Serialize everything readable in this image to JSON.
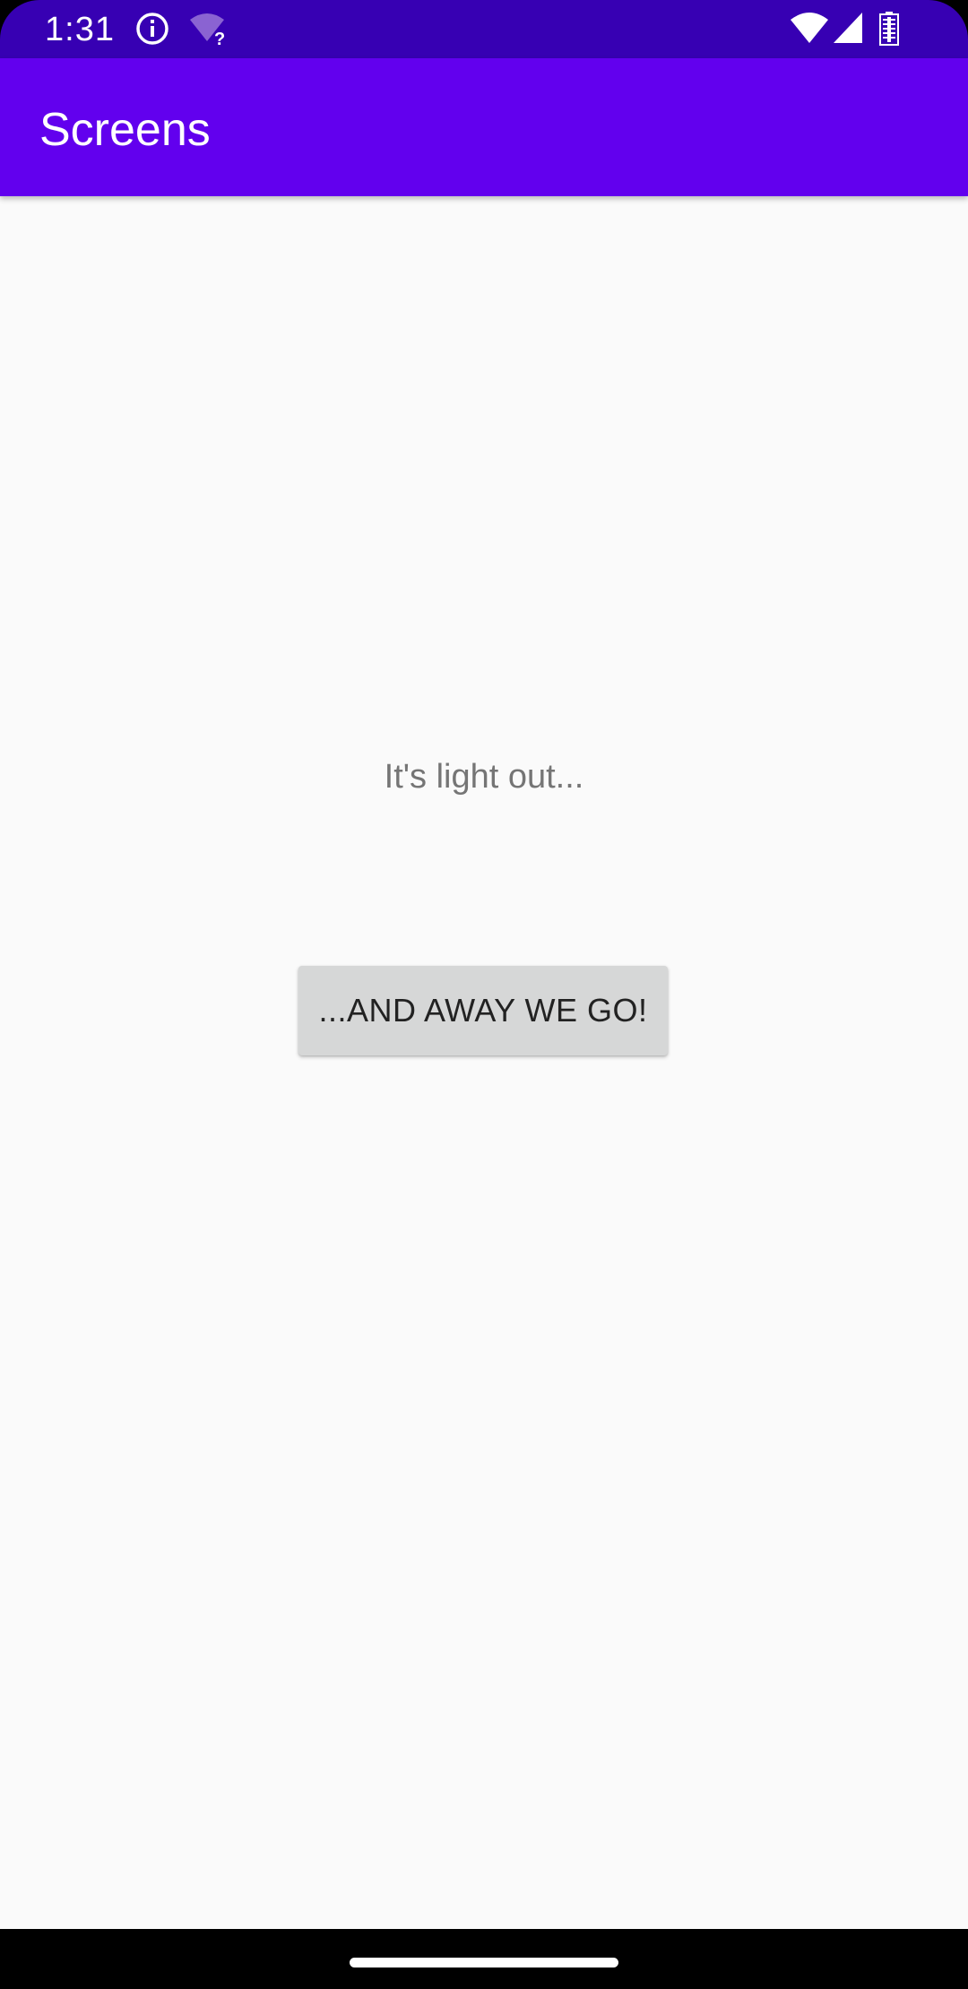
{
  "status_bar": {
    "time": "1:31",
    "icons": [
      "info-icon",
      "wifi-unknown-icon",
      "wifi-icon",
      "cell-signal-icon",
      "battery-icon"
    ],
    "background_color": "#3700b3"
  },
  "app_bar": {
    "title": "Screens",
    "background_color": "#6200ee"
  },
  "main": {
    "message": "It's light out...",
    "button_label": "...AND AWAY WE GO!",
    "background_color": "#fafafa"
  },
  "nav_bar": {
    "home_indicator": "home-pill"
  }
}
